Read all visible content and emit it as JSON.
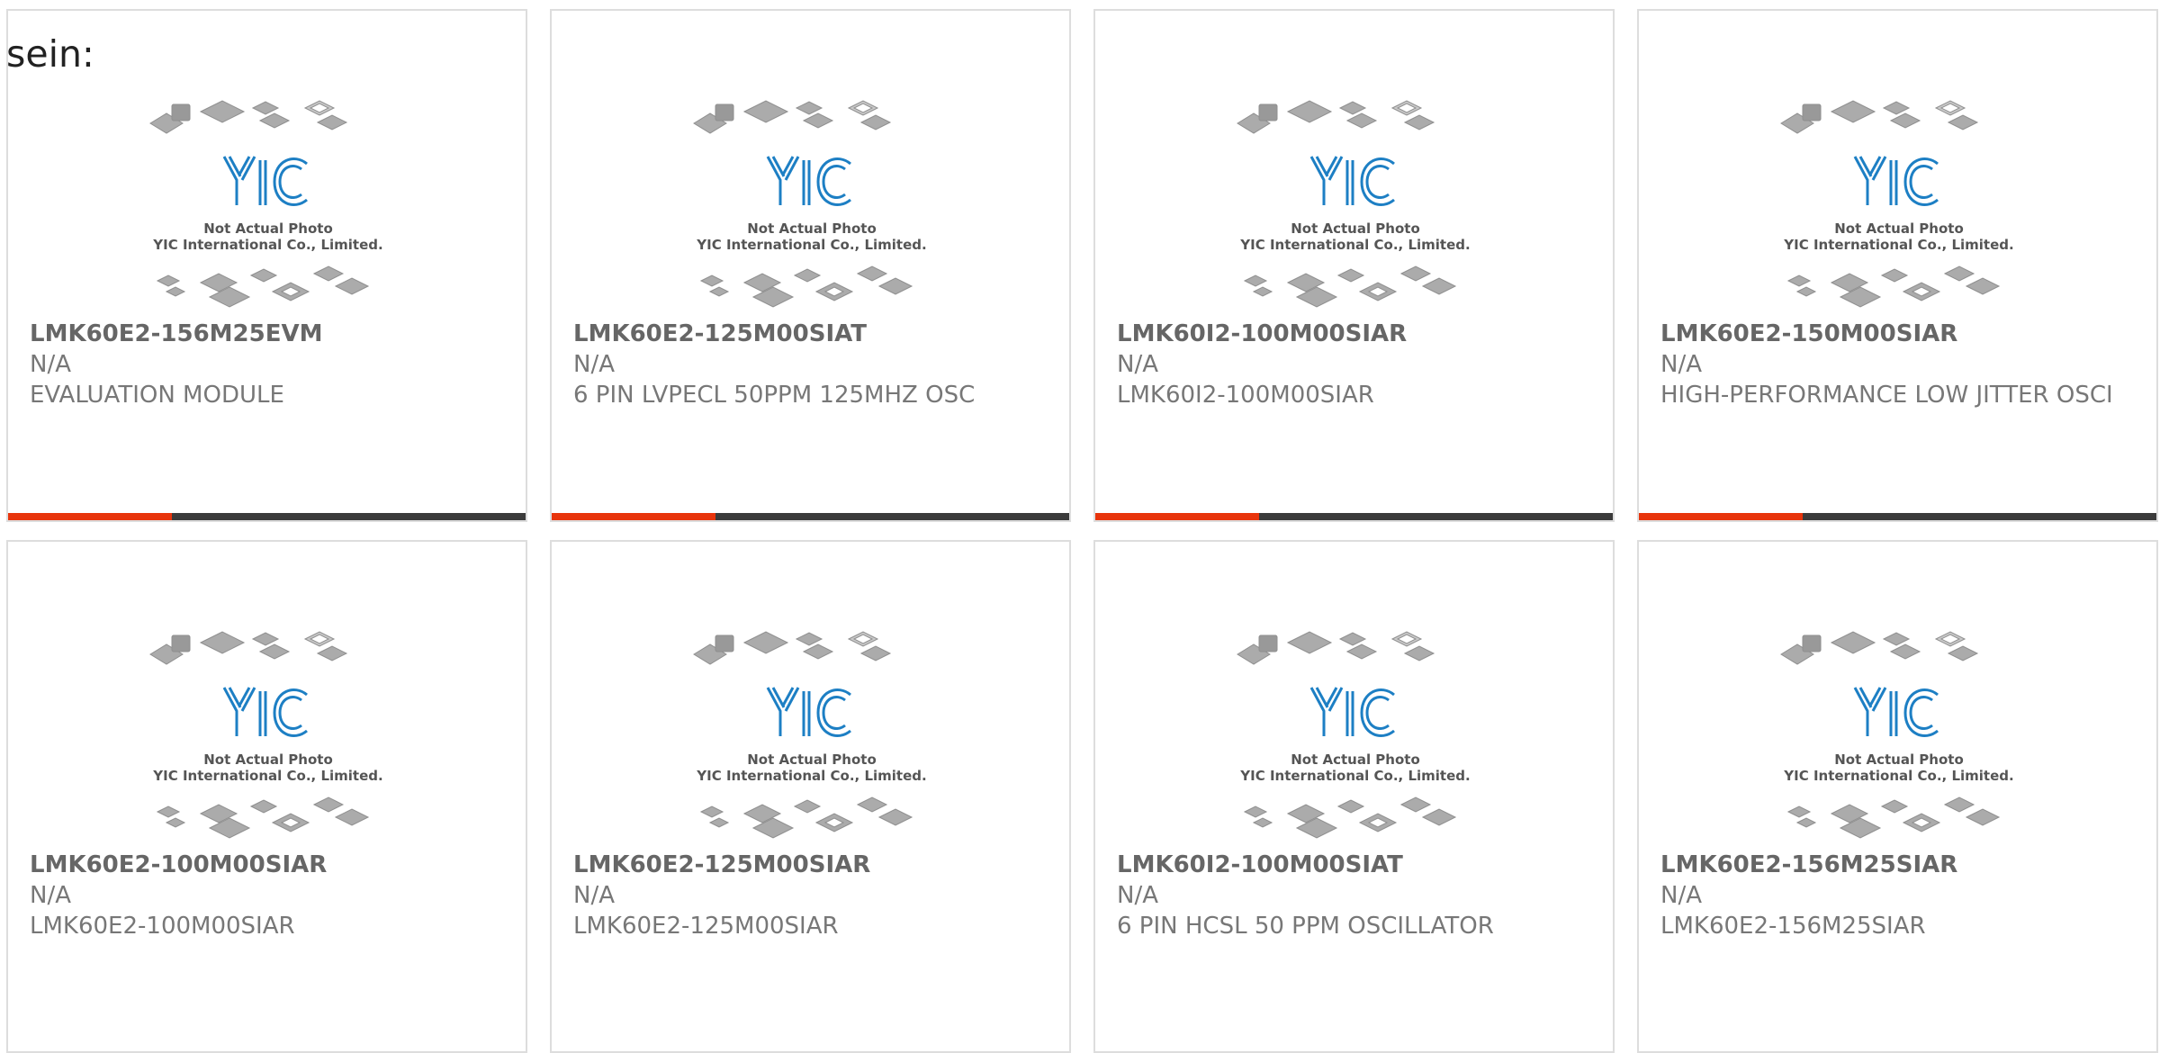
{
  "intro_text": "sein:",
  "photo_caption_line1": "Not Actual Photo",
  "photo_caption_line2": "YIC International Co., Limited.",
  "logo_text": "YIC",
  "colors": {
    "accent": "#e8340c",
    "bar": "#3b3b3b",
    "logo_blue": "#1d7fc4",
    "chip_gray": "#a9a9a9"
  },
  "products": [
    {
      "part_number": "LMK60E2-156M25EVM",
      "manufacturer": "N/A",
      "description": "EVALUATION MODULE"
    },
    {
      "part_number": "LMK60E2-125M00SIAT",
      "manufacturer": "N/A",
      "description": "6 PIN LVPECL 50PPM 125MHZ OSC"
    },
    {
      "part_number": "LMK60I2-100M00SIAR",
      "manufacturer": "N/A",
      "description": "LMK60I2-100M00SIAR"
    },
    {
      "part_number": "LMK60E2-150M00SIAR",
      "manufacturer": "N/A",
      "description": "HIGH-PERFORMANCE LOW JITTER OSCI"
    },
    {
      "part_number": "LMK60E2-100M00SIAR",
      "manufacturer": "N/A",
      "description": "LMK60E2-100M00SIAR"
    },
    {
      "part_number": "LMK60E2-125M00SIAR",
      "manufacturer": "N/A",
      "description": "LMK60E2-125M00SIAR"
    },
    {
      "part_number": "LMK60I2-100M00SIAT",
      "manufacturer": "N/A",
      "description": "6 PIN HCSL 50 PPM OSCILLATOR"
    },
    {
      "part_number": "LMK60E2-156M25SIAR",
      "manufacturer": "N/A",
      "description": "LMK60E2-156M25SIAR"
    }
  ]
}
